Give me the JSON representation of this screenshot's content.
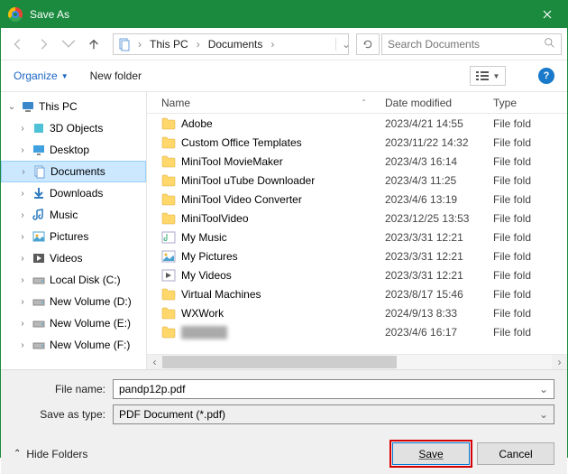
{
  "title": "Save As",
  "breadcrumb": {
    "root": "This PC",
    "folder": "Documents"
  },
  "search": {
    "placeholder": "Search Documents"
  },
  "toolbar": {
    "organize": "Organize",
    "newfolder": "New folder"
  },
  "tree": {
    "root": "This PC",
    "items": [
      {
        "label": "3D Objects",
        "icon": "3d"
      },
      {
        "label": "Desktop",
        "icon": "desktop"
      },
      {
        "label": "Documents",
        "icon": "documents",
        "selected": true
      },
      {
        "label": "Downloads",
        "icon": "downloads"
      },
      {
        "label": "Music",
        "icon": "music"
      },
      {
        "label": "Pictures",
        "icon": "pictures"
      },
      {
        "label": "Videos",
        "icon": "videos"
      },
      {
        "label": "Local Disk (C:)",
        "icon": "drive"
      },
      {
        "label": "New Volume (D:)",
        "icon": "drive"
      },
      {
        "label": "New Volume (E:)",
        "icon": "drive"
      },
      {
        "label": "New Volume (F:)",
        "icon": "drive"
      }
    ]
  },
  "columns": {
    "name": "Name",
    "date": "Date modified",
    "type": "Type"
  },
  "files": [
    {
      "name": "Adobe",
      "date": "2023/4/21 14:55",
      "type": "File folder",
      "icon": "folder"
    },
    {
      "name": "Custom Office Templates",
      "date": "2023/11/22 14:32",
      "type": "File folder",
      "icon": "folder"
    },
    {
      "name": "MiniTool MovieMaker",
      "date": "2023/4/3 16:14",
      "type": "File folder",
      "icon": "folder"
    },
    {
      "name": "MiniTool uTube Downloader",
      "date": "2023/4/3 11:25",
      "type": "File folder",
      "icon": "folder"
    },
    {
      "name": "MiniTool Video Converter",
      "date": "2023/4/6 13:19",
      "type": "File folder",
      "icon": "folder"
    },
    {
      "name": "MiniToolVideo",
      "date": "2023/12/25 13:53",
      "type": "File folder",
      "icon": "folder"
    },
    {
      "name": "My Music",
      "date": "2023/3/31 12:21",
      "type": "File folder",
      "icon": "music-link"
    },
    {
      "name": "My Pictures",
      "date": "2023/3/31 12:21",
      "type": "File folder",
      "icon": "pic-link"
    },
    {
      "name": "My Videos",
      "date": "2023/3/31 12:21",
      "type": "File folder",
      "icon": "vid-link"
    },
    {
      "name": "Virtual Machines",
      "date": "2023/8/17 15:46",
      "type": "File folder",
      "icon": "folder"
    },
    {
      "name": "WXWork",
      "date": "2024/9/13 8:33",
      "type": "File folder",
      "icon": "folder"
    },
    {
      "name": "██████",
      "date": "2023/4/6 16:17",
      "type": "File folder",
      "icon": "folder",
      "blur": true
    }
  ],
  "form": {
    "filename_label": "File name:",
    "filename_value": "pandp12p.pdf",
    "type_label": "Save as type:",
    "type_value": "PDF Document (*.pdf)"
  },
  "actions": {
    "hide": "Hide Folders",
    "save": "Save",
    "cancel": "Cancel"
  }
}
